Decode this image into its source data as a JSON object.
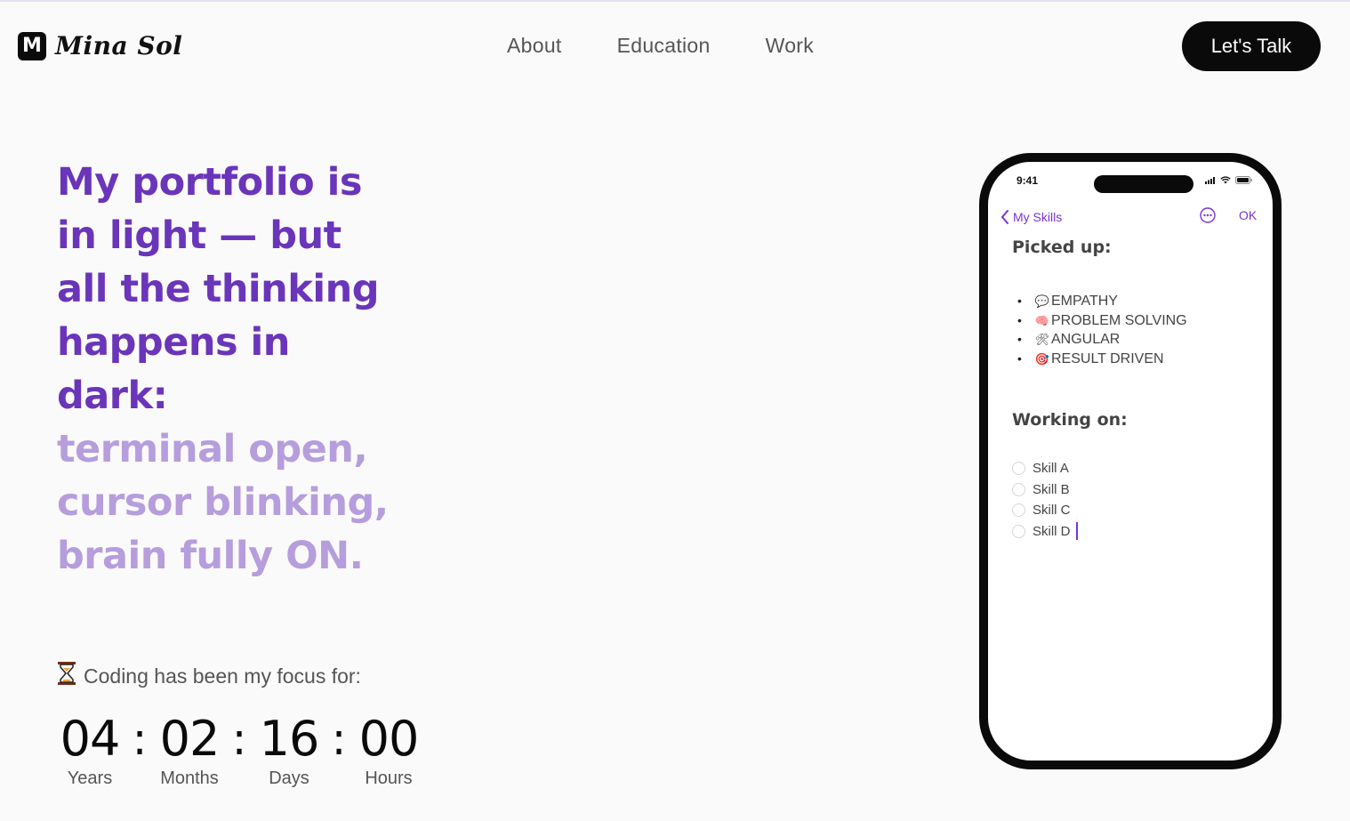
{
  "header": {
    "logo_letter": "M",
    "logo_text": "Mina Sol",
    "nav": [
      "About",
      "Education",
      "Work"
    ],
    "cta_label": "Let's Talk"
  },
  "hero": {
    "dark_lines": [
      "My portfolio is",
      "in light — but",
      "all the thinking",
      "happens in",
      "dark:"
    ],
    "light_lines": [
      "terminal open,",
      "cursor blinking,",
      "brain fully ON."
    ],
    "dark_color": "#6a35b9",
    "light_color": "#b69ddc"
  },
  "focus": {
    "icon": "hourglass-icon",
    "text": "Coding has been my focus for:"
  },
  "counter": [
    {
      "value": "04",
      "label": "Years"
    },
    {
      "value": "02",
      "label": "Months"
    },
    {
      "value": "16",
      "label": "Days"
    },
    {
      "value": "00",
      "label": "Hours"
    }
  ],
  "counter_separator": ":",
  "phone": {
    "time": "9:41",
    "back_label": "My Skills",
    "ok_label": "OK",
    "accent": "#7a33d6",
    "picked_title": "Picked up:",
    "picked": [
      {
        "emoji": "💬",
        "label": "EMPATHY"
      },
      {
        "emoji": "🧠",
        "label": "PROBLEM SOLVING"
      },
      {
        "emoji": "🛠",
        "label": "ANGULAR"
      },
      {
        "emoji": "🎯",
        "label": "RESULT DRIVEN"
      }
    ],
    "working_title": "Working on:",
    "working": [
      "Skill A",
      "Skill B",
      "Skill C",
      "Skill D"
    ]
  }
}
